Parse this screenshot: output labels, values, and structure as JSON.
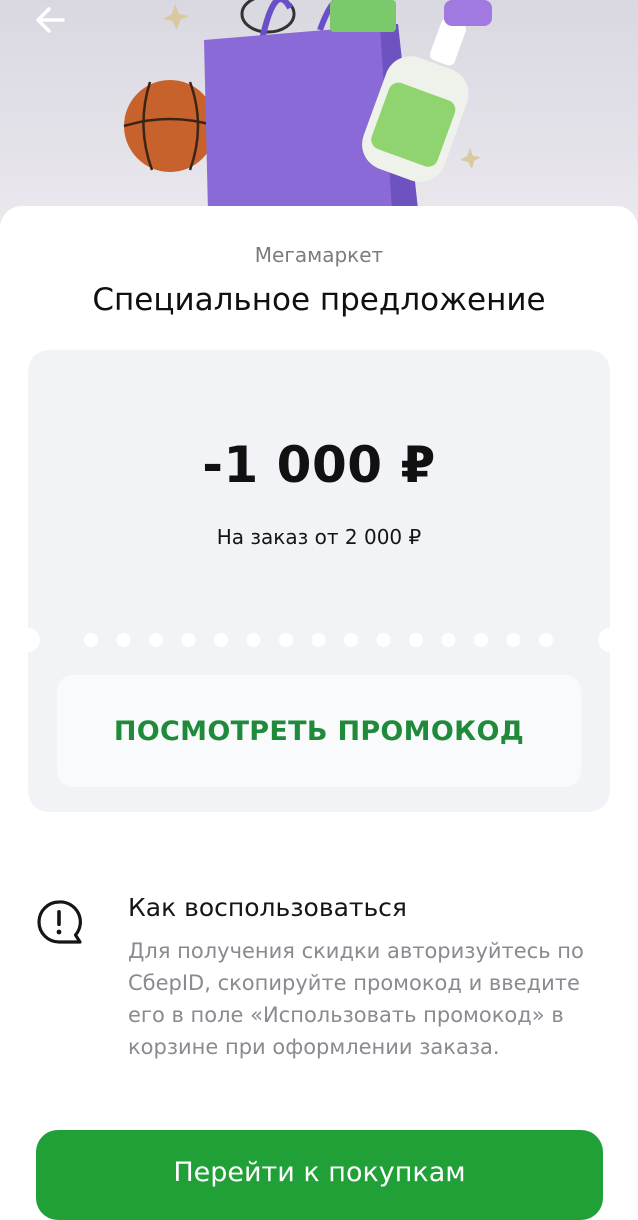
{
  "header": {
    "back_icon": "arrow-left-icon"
  },
  "offer": {
    "brand": "Мегамаркет",
    "title": "Специальное предложение",
    "amount": "-1 000 ₽",
    "condition": "На заказ от 2 000 ₽",
    "promo_button_label": "ПОСМОТРЕТЬ ПРОМОКОД"
  },
  "howto": {
    "icon": "exclamation-speech-bubble-icon",
    "title": "Как воспользоваться",
    "text": "Для получения скидки авторизуйтесь по СберID, скопируйте промокод и введите его в поле «Использовать промокод» в корзине при оформлении заказа."
  },
  "cta": {
    "label": "Перейти к покупкам"
  },
  "colors": {
    "accent_green": "#21a038",
    "promo_text_green": "#1f8b3a",
    "coupon_background": "#f1f3f6",
    "secondary_text": "#8a8a90"
  }
}
